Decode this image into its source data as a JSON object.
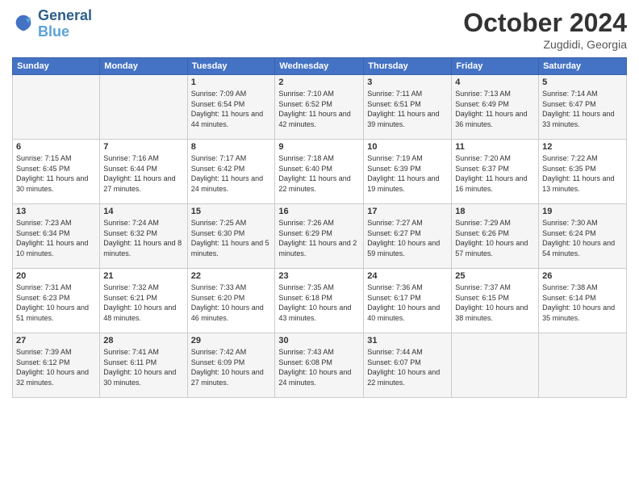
{
  "header": {
    "logo_line1": "General",
    "logo_line2": "Blue",
    "month": "October 2024",
    "location": "Zugdidi, Georgia"
  },
  "days_of_week": [
    "Sunday",
    "Monday",
    "Tuesday",
    "Wednesday",
    "Thursday",
    "Friday",
    "Saturday"
  ],
  "weeks": [
    [
      {
        "day": "",
        "sunrise": "",
        "sunset": "",
        "daylight": ""
      },
      {
        "day": "",
        "sunrise": "",
        "sunset": "",
        "daylight": ""
      },
      {
        "day": "1",
        "sunrise": "Sunrise: 7:09 AM",
        "sunset": "Sunset: 6:54 PM",
        "daylight": "Daylight: 11 hours and 44 minutes."
      },
      {
        "day": "2",
        "sunrise": "Sunrise: 7:10 AM",
        "sunset": "Sunset: 6:52 PM",
        "daylight": "Daylight: 11 hours and 42 minutes."
      },
      {
        "day": "3",
        "sunrise": "Sunrise: 7:11 AM",
        "sunset": "Sunset: 6:51 PM",
        "daylight": "Daylight: 11 hours and 39 minutes."
      },
      {
        "day": "4",
        "sunrise": "Sunrise: 7:13 AM",
        "sunset": "Sunset: 6:49 PM",
        "daylight": "Daylight: 11 hours and 36 minutes."
      },
      {
        "day": "5",
        "sunrise": "Sunrise: 7:14 AM",
        "sunset": "Sunset: 6:47 PM",
        "daylight": "Daylight: 11 hours and 33 minutes."
      }
    ],
    [
      {
        "day": "6",
        "sunrise": "Sunrise: 7:15 AM",
        "sunset": "Sunset: 6:45 PM",
        "daylight": "Daylight: 11 hours and 30 minutes."
      },
      {
        "day": "7",
        "sunrise": "Sunrise: 7:16 AM",
        "sunset": "Sunset: 6:44 PM",
        "daylight": "Daylight: 11 hours and 27 minutes."
      },
      {
        "day": "8",
        "sunrise": "Sunrise: 7:17 AM",
        "sunset": "Sunset: 6:42 PM",
        "daylight": "Daylight: 11 hours and 24 minutes."
      },
      {
        "day": "9",
        "sunrise": "Sunrise: 7:18 AM",
        "sunset": "Sunset: 6:40 PM",
        "daylight": "Daylight: 11 hours and 22 minutes."
      },
      {
        "day": "10",
        "sunrise": "Sunrise: 7:19 AM",
        "sunset": "Sunset: 6:39 PM",
        "daylight": "Daylight: 11 hours and 19 minutes."
      },
      {
        "day": "11",
        "sunrise": "Sunrise: 7:20 AM",
        "sunset": "Sunset: 6:37 PM",
        "daylight": "Daylight: 11 hours and 16 minutes."
      },
      {
        "day": "12",
        "sunrise": "Sunrise: 7:22 AM",
        "sunset": "Sunset: 6:35 PM",
        "daylight": "Daylight: 11 hours and 13 minutes."
      }
    ],
    [
      {
        "day": "13",
        "sunrise": "Sunrise: 7:23 AM",
        "sunset": "Sunset: 6:34 PM",
        "daylight": "Daylight: 11 hours and 10 minutes."
      },
      {
        "day": "14",
        "sunrise": "Sunrise: 7:24 AM",
        "sunset": "Sunset: 6:32 PM",
        "daylight": "Daylight: 11 hours and 8 minutes."
      },
      {
        "day": "15",
        "sunrise": "Sunrise: 7:25 AM",
        "sunset": "Sunset: 6:30 PM",
        "daylight": "Daylight: 11 hours and 5 minutes."
      },
      {
        "day": "16",
        "sunrise": "Sunrise: 7:26 AM",
        "sunset": "Sunset: 6:29 PM",
        "daylight": "Daylight: 11 hours and 2 minutes."
      },
      {
        "day": "17",
        "sunrise": "Sunrise: 7:27 AM",
        "sunset": "Sunset: 6:27 PM",
        "daylight": "Daylight: 10 hours and 59 minutes."
      },
      {
        "day": "18",
        "sunrise": "Sunrise: 7:29 AM",
        "sunset": "Sunset: 6:26 PM",
        "daylight": "Daylight: 10 hours and 57 minutes."
      },
      {
        "day": "19",
        "sunrise": "Sunrise: 7:30 AM",
        "sunset": "Sunset: 6:24 PM",
        "daylight": "Daylight: 10 hours and 54 minutes."
      }
    ],
    [
      {
        "day": "20",
        "sunrise": "Sunrise: 7:31 AM",
        "sunset": "Sunset: 6:23 PM",
        "daylight": "Daylight: 10 hours and 51 minutes."
      },
      {
        "day": "21",
        "sunrise": "Sunrise: 7:32 AM",
        "sunset": "Sunset: 6:21 PM",
        "daylight": "Daylight: 10 hours and 48 minutes."
      },
      {
        "day": "22",
        "sunrise": "Sunrise: 7:33 AM",
        "sunset": "Sunset: 6:20 PM",
        "daylight": "Daylight: 10 hours and 46 minutes."
      },
      {
        "day": "23",
        "sunrise": "Sunrise: 7:35 AM",
        "sunset": "Sunset: 6:18 PM",
        "daylight": "Daylight: 10 hours and 43 minutes."
      },
      {
        "day": "24",
        "sunrise": "Sunrise: 7:36 AM",
        "sunset": "Sunset: 6:17 PM",
        "daylight": "Daylight: 10 hours and 40 minutes."
      },
      {
        "day": "25",
        "sunrise": "Sunrise: 7:37 AM",
        "sunset": "Sunset: 6:15 PM",
        "daylight": "Daylight: 10 hours and 38 minutes."
      },
      {
        "day": "26",
        "sunrise": "Sunrise: 7:38 AM",
        "sunset": "Sunset: 6:14 PM",
        "daylight": "Daylight: 10 hours and 35 minutes."
      }
    ],
    [
      {
        "day": "27",
        "sunrise": "Sunrise: 7:39 AM",
        "sunset": "Sunset: 6:12 PM",
        "daylight": "Daylight: 10 hours and 32 minutes."
      },
      {
        "day": "28",
        "sunrise": "Sunrise: 7:41 AM",
        "sunset": "Sunset: 6:11 PM",
        "daylight": "Daylight: 10 hours and 30 minutes."
      },
      {
        "day": "29",
        "sunrise": "Sunrise: 7:42 AM",
        "sunset": "Sunset: 6:09 PM",
        "daylight": "Daylight: 10 hours and 27 minutes."
      },
      {
        "day": "30",
        "sunrise": "Sunrise: 7:43 AM",
        "sunset": "Sunset: 6:08 PM",
        "daylight": "Daylight: 10 hours and 24 minutes."
      },
      {
        "day": "31",
        "sunrise": "Sunrise: 7:44 AM",
        "sunset": "Sunset: 6:07 PM",
        "daylight": "Daylight: 10 hours and 22 minutes."
      },
      {
        "day": "",
        "sunrise": "",
        "sunset": "",
        "daylight": ""
      },
      {
        "day": "",
        "sunrise": "",
        "sunset": "",
        "daylight": ""
      }
    ]
  ]
}
